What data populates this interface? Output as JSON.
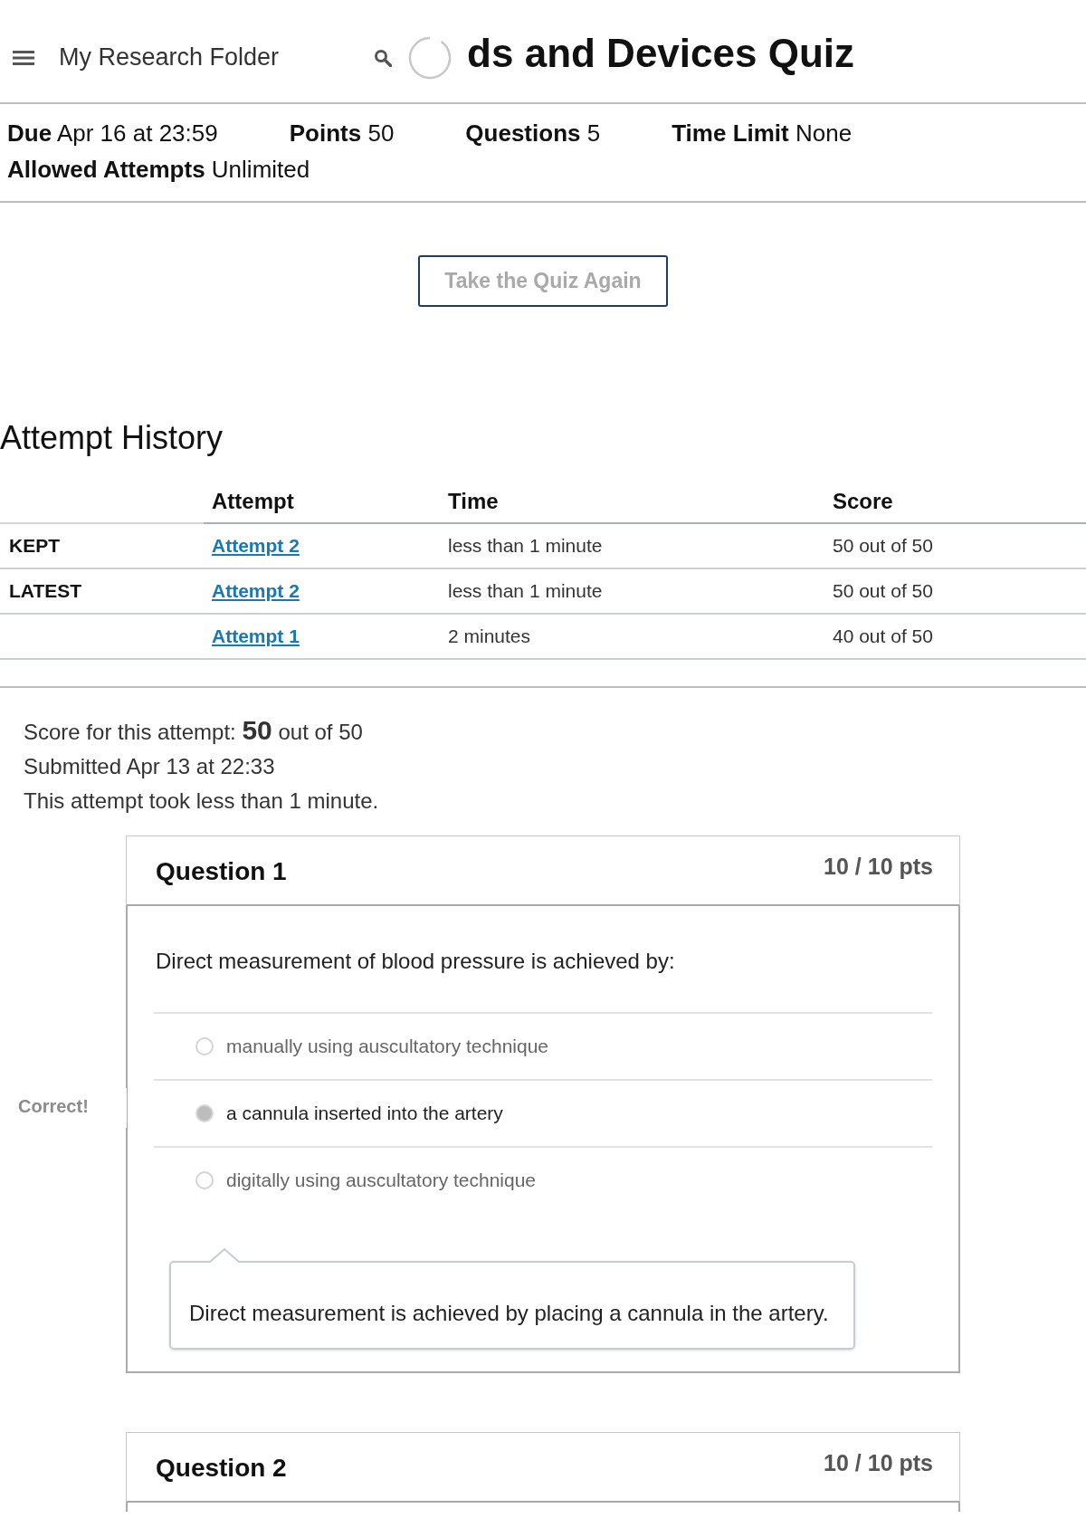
{
  "header": {
    "folder_title": "My Research Folder",
    "quiz_title": "ds and Devices Quiz"
  },
  "details": [
    {
      "label": "Due",
      "value": "Apr 16 at 23:59"
    },
    {
      "label": "Points",
      "value": "50"
    },
    {
      "label": "Questions",
      "value": "5"
    },
    {
      "label": "Time Limit",
      "value": "None"
    },
    {
      "label": "Allowed Attempts",
      "value": "Unlimited"
    }
  ],
  "retake_button": "Take the Quiz Again",
  "attempt_history": {
    "title": "Attempt History",
    "columns": [
      "Attempt",
      "Time",
      "Score"
    ],
    "rows": [
      {
        "status": "KEPT",
        "attempt": "Attempt 2",
        "time": "less than 1 minute",
        "score": "50 out of 50"
      },
      {
        "status": "LATEST",
        "attempt": "Attempt 2",
        "time": "less than 1 minute",
        "score": "50 out of 50"
      },
      {
        "attempt": "Attempt 1",
        "time": "2 minutes",
        "score": "40 out of 50"
      }
    ]
  },
  "attempt_summary": {
    "score": "Score for this attempt: **50** out of 50",
    "submitted": "Submitted Apr 13 at 22:33",
    "duration": "This attempt took less than 1 minute."
  },
  "questions": [
    {
      "title": "Question 1",
      "points": "10 / 10 pts",
      "prompt": "Direct measurement of blood pressure is achieved by:",
      "answers": [
        {
          "text": "manually using auscultatory technique",
          "selected": false
        },
        {
          "text": "a cannula inserted into the artery",
          "selected": true,
          "result": "Correct!"
        },
        {
          "text": "digitally using auscultatory technique",
          "selected": false
        }
      ],
      "comment": "Direct measurement is achieved by placing a cannula in the artery."
    },
    {
      "title": "Question 2",
      "points": "10 / 10 pts"
    }
  ]
}
